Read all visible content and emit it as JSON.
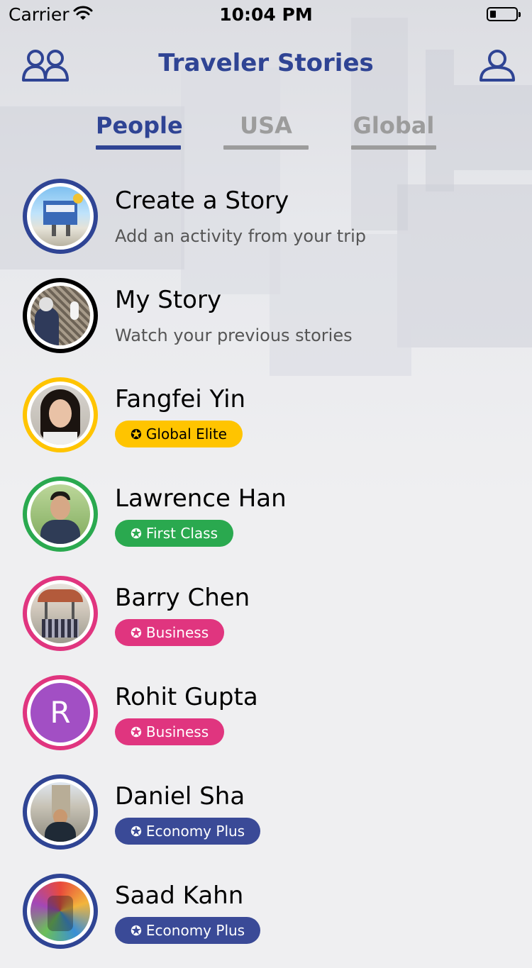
{
  "status_bar": {
    "carrier": "Carrier",
    "time": "10:04 PM"
  },
  "nav": {
    "title": "Traveler Stories",
    "left_icon": "people-icon",
    "right_icon": "user-icon"
  },
  "tabs": [
    {
      "label": "People",
      "active": true
    },
    {
      "label": "USA",
      "active": false
    },
    {
      "label": "Global",
      "active": false
    }
  ],
  "colors": {
    "brand": "#2f4494",
    "global_elite": "#ffc400",
    "first_class": "#2aa94f",
    "business": "#e0357f",
    "economy_plus": "#3a4a97"
  },
  "stories": [
    {
      "title": "Create a Story",
      "subtitle": "Add an activity from your trip",
      "ring": "#2f4494"
    },
    {
      "title": "My Story",
      "subtitle": "Watch your previous stories",
      "ring": "#000000"
    },
    {
      "title": "Fangfei Yin",
      "badge": "Global Elite",
      "ring": "#ffc400"
    },
    {
      "title": "Lawrence Han",
      "badge": "First Class",
      "ring": "#2aa94f"
    },
    {
      "title": "Barry Chen",
      "badge": "Business",
      "ring": "#e0357f"
    },
    {
      "title": "Rohit Gupta",
      "badge": "Business",
      "ring": "#e0357f",
      "initial": "R"
    },
    {
      "title": "Daniel Sha",
      "badge": "Economy Plus",
      "ring": "#2f4494"
    },
    {
      "title": "Saad Kahn",
      "badge": "Economy Plus",
      "ring": "#2f4494"
    }
  ]
}
